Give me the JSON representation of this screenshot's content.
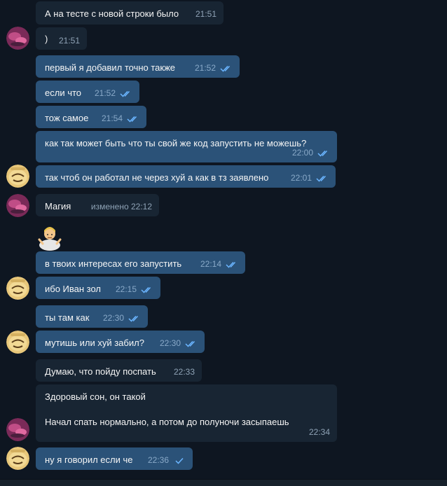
{
  "messages": [
    {
      "text": "А на тесте с новой строки было",
      "time": "21:51"
    },
    {
      "text": ")",
      "time": "21:51"
    },
    {
      "text": "первый я добавил точно также",
      "time": "21:52"
    },
    {
      "text": "если что",
      "time": "21:52"
    },
    {
      "text": "тож самое",
      "time": "21:54"
    },
    {
      "text": "как так может быть что ты свой же код запустить не можешь?",
      "time": "22:00"
    },
    {
      "text": "так чтоб он работал не через хуй а как в тз заявлено",
      "time": "22:01"
    },
    {
      "text": "Магия",
      "time": "изменено 22:12"
    },
    {
      "text": "в твоих интересах его запустить",
      "time": "22:14"
    },
    {
      "text": "ибо Иван зол",
      "time": "22:15"
    },
    {
      "text": "ты там как",
      "time": "22:30"
    },
    {
      "text": "мутишь или хуй забил?",
      "time": "22:30"
    },
    {
      "text": "Думаю, что пойду поспать",
      "time": "22:33"
    },
    {
      "text": "Здоровый сон, он такой",
      "text2": "Начал спать нормально, а потом до полуночи засыпаешь",
      "time": "22:34"
    },
    {
      "text": "ну я говорил если че",
      "time": "22:36"
    }
  ],
  "colors": {
    "background": "#0e1621",
    "incoming_bubble": "#182533",
    "outgoing_bubble": "#2b5278",
    "read_check": "#6bb5ff"
  }
}
